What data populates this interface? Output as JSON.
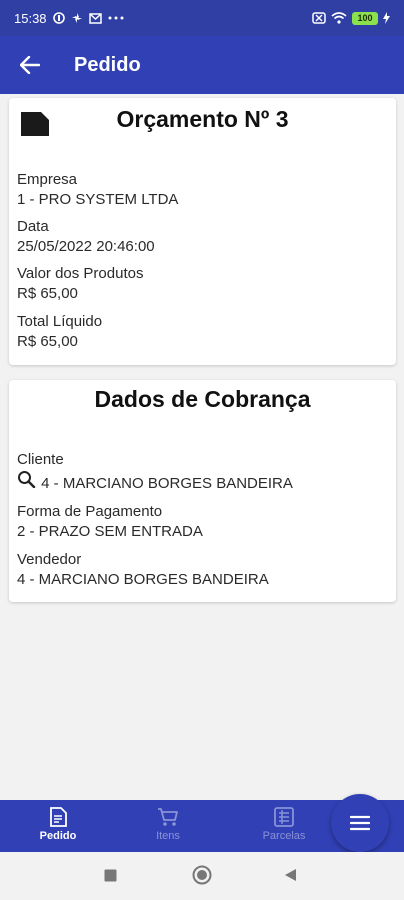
{
  "status_bar": {
    "time": "15:38",
    "battery": "100"
  },
  "app_bar": {
    "title": "Pedido"
  },
  "orcamento": {
    "title": "Orçamento Nº 3",
    "empresa_label": "Empresa",
    "empresa_value": "1 - PRO SYSTEM LTDA",
    "data_label": "Data",
    "data_value": "25/05/2022 20:46:00",
    "valor_label": "Valor dos Produtos",
    "valor_value": "R$ 65,00",
    "total_label": "Total Líquido",
    "total_value": "R$ 65,00"
  },
  "cobranca": {
    "title": "Dados de Cobrança",
    "cliente_label": "Cliente",
    "cliente_value": "4 - MARCIANO BORGES BANDEIRA",
    "forma_label": "Forma de Pagamento",
    "forma_value": "2 - PRAZO SEM ENTRADA",
    "vendedor_label": "Vendedor",
    "vendedor_value": "4 - MARCIANO BORGES BANDEIRA"
  },
  "bottom_nav": {
    "items": [
      {
        "label": "Pedido",
        "icon": "document-icon",
        "active": true
      },
      {
        "label": "Itens",
        "icon": "cart-icon",
        "active": false
      },
      {
        "label": "Parcelas",
        "icon": "list-icon",
        "active": false
      }
    ],
    "fab_icon": "menu-icon"
  },
  "colors": {
    "primary": "#3140b5",
    "status_bar": "#2f3fa4",
    "inactive_nav": "#8a93d6",
    "background": "#f2f2f2"
  }
}
